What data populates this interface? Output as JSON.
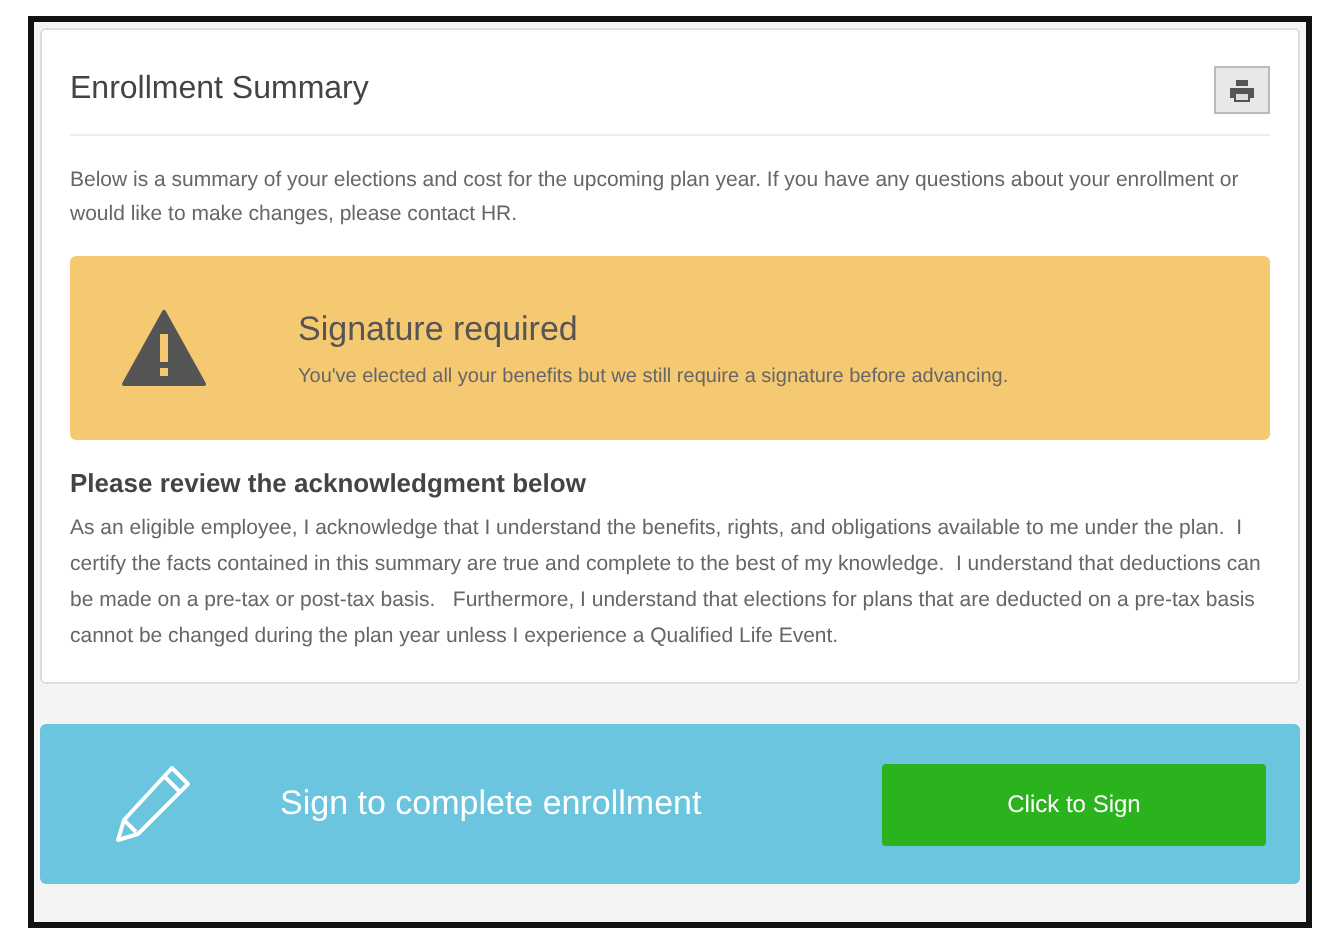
{
  "panel": {
    "title": "Enrollment Summary",
    "intro": "Below is a summary of your elections and cost for the upcoming plan year. If you have any questions about your enrollment or would like to make changes, please contact HR."
  },
  "alert": {
    "kind": "warning",
    "title": "Signature required",
    "message": "You've elected all your benefits but we still require a signature before advancing."
  },
  "acknowledgment": {
    "heading": "Please review the acknowledgment below",
    "text": "As an eligible employee, I acknowledge that I understand the benefits, rights, and obligations available to me under the plan.  I certify the facts contained in this summary are true and complete to the best of my knowledge.  I understand that deductions can be made on a pre-tax or post-tax basis.   Furthermore, I understand that elections for plans that are deducted on a pre-tax basis cannot be changed during the plan year unless I experience a Qualified Life Event."
  },
  "sign_bar": {
    "label": "Sign to complete enrollment",
    "button": "Click to Sign"
  }
}
